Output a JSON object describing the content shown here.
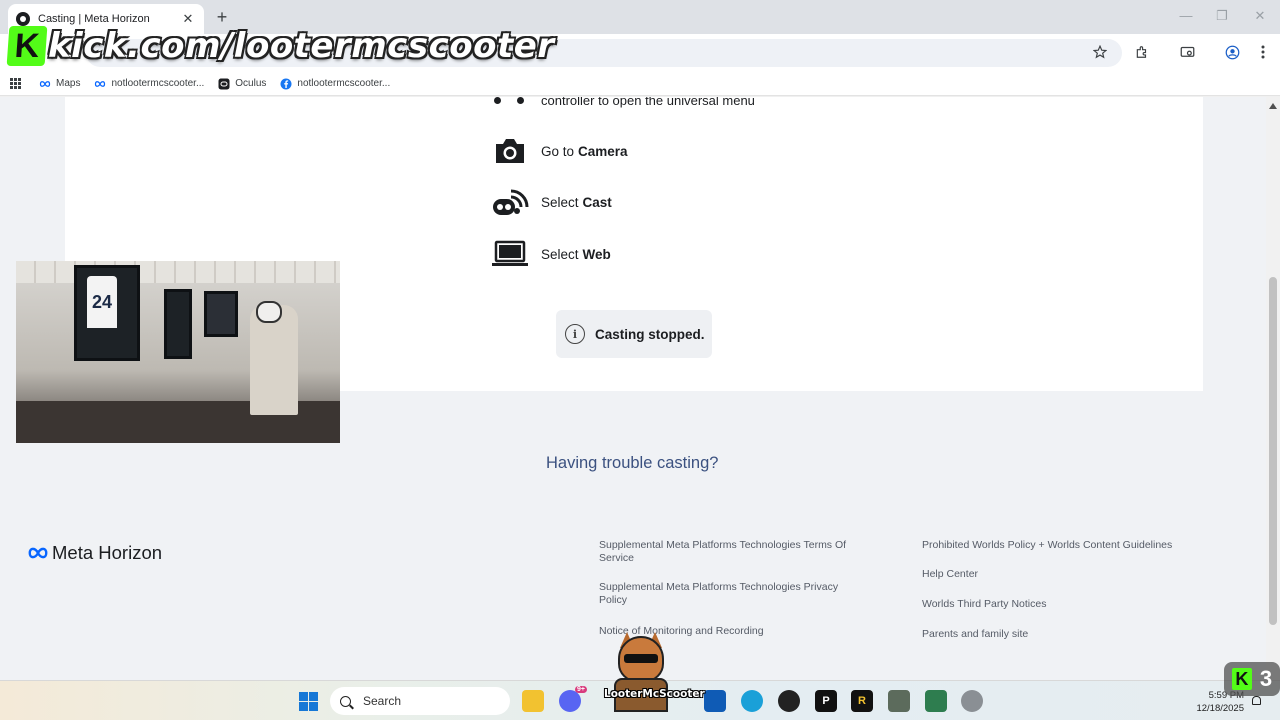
{
  "browser": {
    "tab_title": "Casting | Meta Horizon",
    "new_tab_icon": "+",
    "close_icon": "✕",
    "window_controls": [
      "—",
      "❐",
      "✕"
    ]
  },
  "stream_overlay": {
    "url_text": "kick.com/lootermcscooter",
    "logo_letter": "K",
    "badge_count": "3",
    "mascot_name": "LooterMcScooter"
  },
  "bookmarks": [
    {
      "label": "Maps",
      "icon": "meta-infinity-icon"
    },
    {
      "label": "notlootermcscooter...",
      "icon": "meta-infinity-icon"
    },
    {
      "label": "Oculus",
      "icon": "oculus-icon"
    },
    {
      "label": "notlootermcscooter...",
      "icon": "facebook-icon"
    }
  ],
  "instructions": {
    "partial_line": "controller to open the universal menu",
    "steps": [
      {
        "prefix": "Go to",
        "bold": "Camera",
        "icon": "camera-icon"
      },
      {
        "prefix": "Select",
        "bold": "Cast",
        "icon": "cast-icon"
      },
      {
        "prefix": "Select",
        "bold": "Web",
        "icon": "laptop-icon"
      }
    ]
  },
  "toast": {
    "message": "Casting stopped.",
    "icon": "i"
  },
  "help_link": "Having trouble casting?",
  "footer": {
    "brand": "Meta Horizon",
    "links_col1": [
      "Supplemental Meta Platforms Technologies Terms Of Service",
      "Supplemental Meta Platforms Technologies Privacy Policy",
      "Notice of Monitoring and Recording"
    ],
    "links_col2": [
      "Prohibited Worlds Policy + Worlds Content Guidelines",
      "Help Center",
      "Worlds Third Party Notices",
      "Parents and family site"
    ]
  },
  "webcam": {
    "jersey_number": "24"
  },
  "taskbar": {
    "search_placeholder": "Search",
    "time": "5:59 PM",
    "date": "12/18/2025",
    "discord_badge": "9+"
  }
}
